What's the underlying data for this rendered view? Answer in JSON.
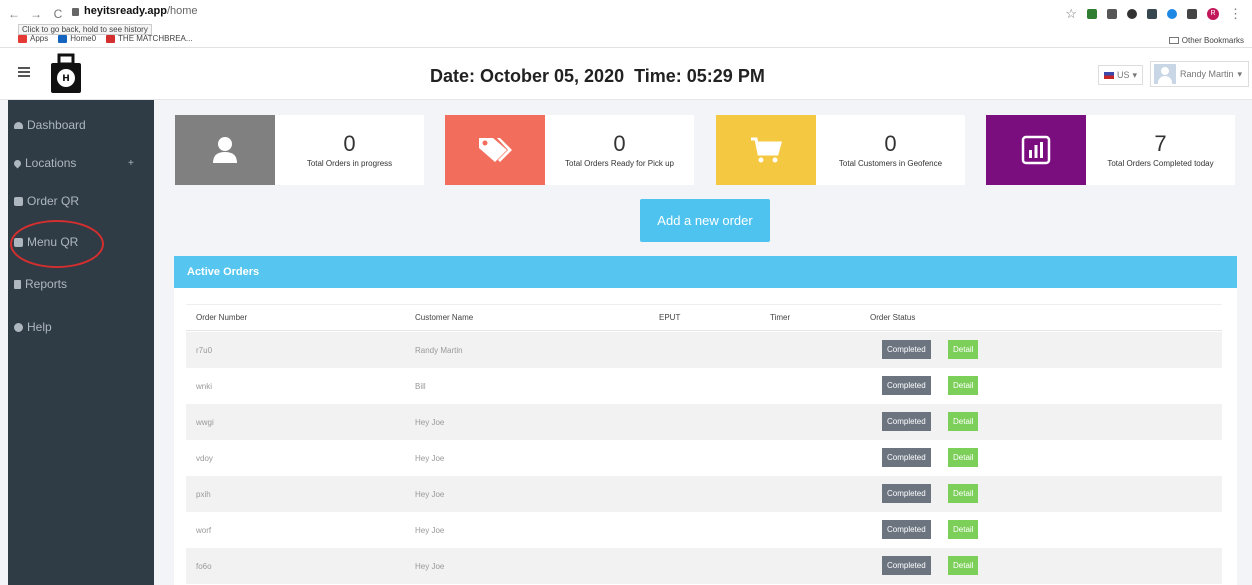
{
  "browser": {
    "url_host": "heyitsready.app",
    "url_path": "/home",
    "tooltip": "Click to go back, hold to see history",
    "bookmarks": [
      {
        "label": "Apps",
        "color": "#e53935"
      },
      {
        "label": "Home0",
        "color": "#1565c0"
      },
      {
        "label": "THE MATCHBREA...",
        "color": "#d32f2f"
      }
    ],
    "other_bookmarks": "Other Bookmarks",
    "profile_initial": "R"
  },
  "header": {
    "date_text": "Date: October 05, 2020",
    "time_text": "Time: 05:29 PM",
    "locale": "US",
    "user_name": "Randy Martin"
  },
  "sidebar": {
    "items": [
      {
        "label": "Dashboard",
        "icon": "dashboard-icon"
      },
      {
        "label": "Locations",
        "icon": "map-pin-icon"
      },
      {
        "label": "Order QR",
        "icon": "qr-icon"
      },
      {
        "label": "Menu QR",
        "icon": "qr-icon"
      },
      {
        "label": "Reports",
        "icon": "document-icon"
      },
      {
        "label": "Help",
        "icon": "help-icon"
      }
    ],
    "expand_symbol": "+"
  },
  "stats": [
    {
      "value": "0",
      "label": "Total Orders in progress",
      "color": "#808080",
      "icon": "user-icon"
    },
    {
      "value": "0",
      "label": "Total Orders Ready for Pick up",
      "color": "#f26d5b",
      "icon": "tags-icon"
    },
    {
      "value": "0",
      "label": "Total Customers in Geofence",
      "color": "#f5c842",
      "icon": "cart-icon"
    },
    {
      "value": "7",
      "label": "Total Orders Completed today",
      "color": "#7b0e7f",
      "icon": "bar-chart-icon"
    }
  ],
  "add_order_label": "Add a new order",
  "orders": {
    "title": "Active Orders",
    "columns": [
      "Order Number",
      "Customer Name",
      "EPUT",
      "Timer",
      "Order Status"
    ],
    "rows": [
      {
        "order": "r7u0",
        "customer": "Randy Martin",
        "eput": "",
        "timer": "",
        "status": "Completed",
        "action": "Detail"
      },
      {
        "order": "wnki",
        "customer": "Bill",
        "eput": "",
        "timer": "",
        "status": "Completed",
        "action": "Detail"
      },
      {
        "order": "wwgi",
        "customer": "Hey Joe",
        "eput": "",
        "timer": "",
        "status": "Completed",
        "action": "Detail"
      },
      {
        "order": "vdoy",
        "customer": "Hey Joe",
        "eput": "",
        "timer": "",
        "status": "Completed",
        "action": "Detail"
      },
      {
        "order": "pxih",
        "customer": "Hey Joe",
        "eput": "",
        "timer": "",
        "status": "Completed",
        "action": "Detail"
      },
      {
        "order": "worf",
        "customer": "Hey Joe",
        "eput": "",
        "timer": "",
        "status": "Completed",
        "action": "Detail"
      },
      {
        "order": "fo6o",
        "customer": "Hey Joe",
        "eput": "",
        "timer": "",
        "status": "Completed",
        "action": "Detail"
      }
    ]
  }
}
